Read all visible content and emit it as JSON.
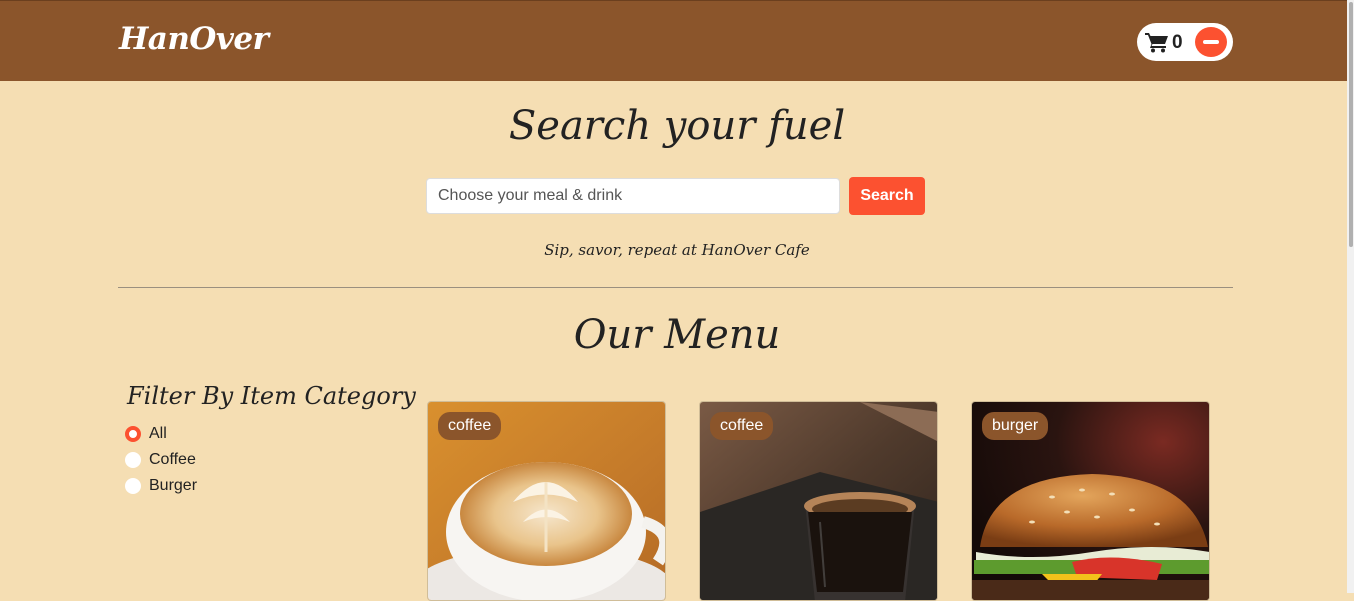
{
  "navbar": {
    "brand": "HanOver",
    "cart_count": "0",
    "cart_icon": "shopping-cart-icon",
    "remove_icon": "minus-circle-icon"
  },
  "hero": {
    "title": "Search your fuel",
    "search": {
      "placeholder": "Choose your meal & drink",
      "value": ""
    },
    "search_button": "Search",
    "tagline": "Sip, savor, repeat at HanOver Cafe"
  },
  "menu": {
    "title": "Our Menu",
    "filter": {
      "title": "Filter By Item Category",
      "options": [
        {
          "label": "All",
          "checked": true
        },
        {
          "label": "Coffee",
          "checked": false
        },
        {
          "label": "Burger",
          "checked": false
        }
      ]
    },
    "items": [
      {
        "category": "coffee",
        "image": "latte-art-photo"
      },
      {
        "category": "coffee",
        "image": "espresso-glass-photo"
      },
      {
        "category": "burger",
        "image": "burger-photo"
      }
    ]
  },
  "colors": {
    "navbar": "#8b552b",
    "background": "#f5deb3",
    "accent": "#fc5130"
  }
}
